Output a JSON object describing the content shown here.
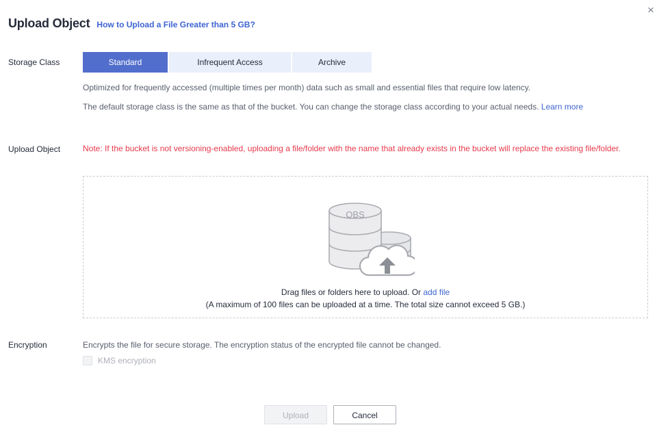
{
  "dialog": {
    "title": "Upload Object",
    "help_link": "How to Upload a File Greater than 5 GB?",
    "close_glyph": "×"
  },
  "storage_class": {
    "label": "Storage Class",
    "tabs": [
      {
        "label": "Standard",
        "selected": true
      },
      {
        "label": "Infrequent Access",
        "selected": false
      },
      {
        "label": "Archive",
        "selected": false
      }
    ],
    "description": "Optimized for frequently accessed (multiple times per month) data such as small and essential files that require low latency.",
    "default_note": "The default storage class is the same as that of the bucket. You can change the storage class according to your actual needs.",
    "learn_more": "Learn more"
  },
  "upload_object": {
    "label": "Upload Object",
    "warning": "Note: If the bucket is not versioning-enabled, uploading a file/folder with the name that already exists in the bucket will replace the existing file/folder.",
    "illustration_text": "OBS",
    "illustration_icon": "obs-upload-icon",
    "drag_text": "Drag files or folders here to upload. Or",
    "add_file": "add file",
    "limit_text": "(A maximum of 100 files can be uploaded at a time. The total size cannot exceed 5 GB.)"
  },
  "encryption": {
    "label": "Encryption",
    "description": "Encrypts the file for secure storage. The encryption status of the encrypted file cannot be changed.",
    "kms_label": "KMS encryption",
    "kms_checked": false,
    "kms_disabled": true
  },
  "footer": {
    "upload_label": "Upload",
    "upload_disabled": true,
    "cancel_label": "Cancel"
  },
  "colors": {
    "accent": "#526ecc",
    "link": "#3d63d1",
    "warning": "#e6394b",
    "tab_inactive": "#e9effb"
  }
}
